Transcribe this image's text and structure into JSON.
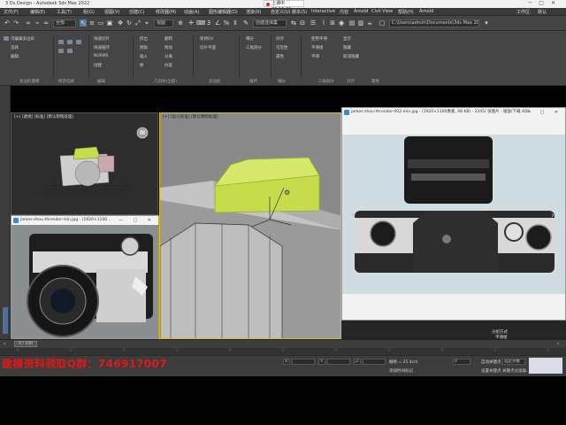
{
  "titlebar": {
    "title": "3 Ds Design - Autodesk 3ds Max 2022",
    "recording": "上课中 00:15:21"
  },
  "menubar": {
    "items": [
      "文件(F)",
      "编辑(E)",
      "工具(T)",
      "组(G)",
      "视图(V)",
      "创建(C)",
      "修改器(M)",
      "动画(A)",
      "图形编辑器(D)",
      "渲染(R)",
      "自定义(U)",
      "脚本(S)",
      "Interactive",
      "内容",
      "Arnold",
      "Civil View",
      "帮助(H)",
      "Arnold"
    ],
    "workspace_label": "工作区:",
    "workspace_value": "默认"
  },
  "toolbar": {
    "selection_filter": "全部",
    "view_mode": "视图",
    "named_sel": "创建选择集",
    "path": "C:\\Users\\admin\\Documents\\3ds Max 2022"
  },
  "ribbon": {
    "left_items": [
      "可编辑多边形",
      "选择",
      "编辑",
      "几何体(全部)",
      "细分",
      "三角剖分",
      "对齐",
      "可见性",
      "属性"
    ],
    "mid_items": [
      "快速切片",
      "快速循环",
      "NURMS",
      "创建",
      "挤出",
      "倒角",
      "插入",
      "桥",
      "翻转",
      "附加",
      "分离",
      "约束",
      "保持UV",
      "切片平面"
    ],
    "right_items": [
      "使用平滑",
      "平滑组",
      "平滑",
      "显示",
      "隐藏",
      "取消隐藏"
    ],
    "groups": [
      "多边形建模",
      "修改选择",
      "编辑",
      "几何体(全部)",
      "多边形",
      "循环",
      "细分",
      "三角剖分",
      "对齐",
      "属性"
    ]
  },
  "viewports": {
    "top_left_label": "[+] [透视] [标准] [默认明暗处理]",
    "main_label": "[+] [前] [标准] [默认明暗处理]"
  },
  "image_viewer_big": {
    "title": "james-zhou-thrender-002-min.jpg - (1920×1100像素, 98 KB) - 2345/ 张图片 - 缩放/下载 40%",
    "controls": "— □ ✕"
  },
  "image_viewer_small": {
    "title": "james-zhou-thrender-min.jpg - (1920×1100...",
    "controls": "— □ ✕"
  },
  "timeline": {
    "frame": "0 / 100"
  },
  "status": {
    "watermark": "建模资料领取Q群：746917007",
    "coords": [
      "X:",
      "Y:",
      "Z:"
    ],
    "grid": "栅格 = 25.4cm",
    "add_time_tag": "添加时间标记",
    "auto_key": "自动关键点",
    "set_key": "设置关键点",
    "selected": "选定对象",
    "key_filter": "关键点过滤器...",
    "frame_value": "0"
  },
  "right_panel": {
    "label1": "分组方式",
    "label2": "平滑组",
    "label3": "显示"
  },
  "colors": {
    "accent_selection": "#e0c000",
    "model_green": "#c6dc4a",
    "watermark_red": "#e01818"
  }
}
